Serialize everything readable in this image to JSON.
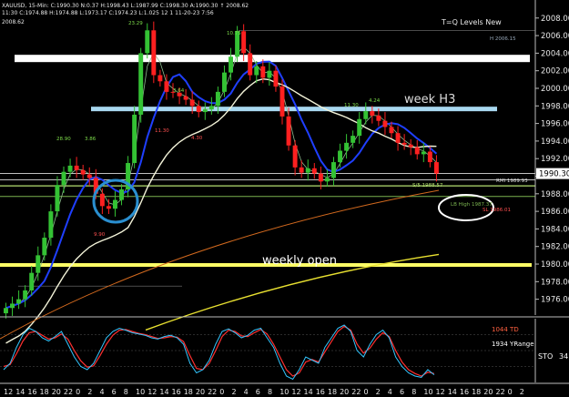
{
  "header": {
    "symbol_line": "XAUUSD, 15-Min: C:1990.30 N:0.37 H:1998.43 L:1987.99 C:1998.30 A:1990.30 ↑ 2008.62",
    "line2": "11:30 C:1974.88 H:1974.88 L:1973.17 C:1974.23 L:1.025 12 1 11-20-23 7:56",
    "left_value": "2008.62"
  },
  "chart_data": {
    "type": "candlestick",
    "title": "T=Q Levels New",
    "ylim": [
      1974,
      2009
    ],
    "y_ticks": [
      1976,
      1978,
      1980,
      1982,
      1984,
      1986,
      1988,
      1990,
      1992,
      1994,
      1996,
      1998,
      2000,
      2002,
      2004,
      2006,
      2008
    ],
    "y_tick_labels": [
      "1976.00",
      "1978.00",
      "1980.00",
      "1982.00",
      "1984.00",
      "1986.00",
      "1988.00",
      "1990.00",
      "1992.00",
      "1994.00",
      "1996.00",
      "1998.00",
      "2000.00",
      "2002.00",
      "2004.00",
      "2006.00",
      "2008.00"
    ],
    "last_price": "1990.30",
    "x_tick_labels": [
      "12",
      "14",
      "16",
      "18",
      "20",
      "22",
      "0",
      "2",
      "4",
      "6",
      "8",
      "10",
      "12",
      "14",
      "16",
      "18",
      "20",
      "22",
      "0",
      "2",
      "4",
      "6",
      "8",
      "10",
      "12",
      "14",
      "16",
      "18",
      "20",
      "22",
      "0",
      "2",
      "4",
      "6",
      "8",
      "10",
      "12",
      "14",
      "16",
      "18",
      "20",
      "22",
      "0",
      "2"
    ],
    "close_series": [
      1975,
      1975.5,
      1976,
      1977,
      1979,
      1981,
      1983,
      1986,
      1989,
      1990.5,
      1991.2,
      1990.7,
      1990.2,
      1989.8,
      1988,
      1986.6,
      1986.3,
      1987.3,
      1988.5,
      1991.5,
      1997,
      2004,
      2006.6,
      2001.5,
      2000.8,
      1999.6,
      1999.5,
      1999.1,
      1998.7,
      1998,
      1997.3,
      1997.6,
      1998,
      1999.6,
      2001.8,
      2003.6,
      2006.5,
      2004,
      2001.5,
      2002.5,
      2001.2,
      2002,
      2000.2,
      1996.8,
      1993.5,
      1991,
      1990.4,
      1990.9,
      1990.3,
      1989.4,
      1989.8,
      1991.6,
      1992.9,
      1993.8,
      1994.6,
      1996.5,
      1997.4,
      1996.9,
      1996.3,
      1995.6,
      1994.9,
      1993.8,
      1993.6,
      1993.3,
      1992.5,
      1992.8,
      1991.6,
      1990.3
    ],
    "horizontal_levels": [
      {
        "name": "week-h4",
        "value": 2003.4,
        "color": "#ffffff"
      },
      {
        "name": "week-h3",
        "value": 1997.6,
        "color": "#a8d8f0"
      },
      {
        "name": "weekly-open",
        "value": 1979.9,
        "color": "#ffff66"
      },
      {
        "name": "m5-level",
        "value": 1990.3,
        "color": "#ffffff"
      },
      {
        "name": "h5-level",
        "value": 1989.6,
        "color": "#ffffff"
      },
      {
        "name": "green-level",
        "value": 1988.9,
        "color": "#b4e070"
      },
      {
        "name": "green-level-2",
        "value": 1987.7,
        "color": "#7ab34f"
      }
    ],
    "moving_averages": [
      {
        "name": "ma-blue",
        "color": "#1f3fff"
      },
      {
        "name": "ma-white",
        "color": "#f2f2d8"
      },
      {
        "name": "ma-orange",
        "color": "#d2691e"
      },
      {
        "name": "ma-yellow",
        "color": "#e8e030"
      },
      {
        "name": "ma-thin",
        "color": "#8fbc8f"
      }
    ],
    "annotations": {
      "week_h3": "week H3",
      "weekly_open": "weekly open",
      "peak_a": "23.29",
      "peak_b": "10.75",
      "peak_c": "2006.15",
      "peak_c_prefix": "H",
      "label_s1": "11.30",
      "label_s2": "4.24",
      "label_r1": "28.90",
      "label_r2": "3.86",
      "label_low": "9.90",
      "label_mid1": "3.64",
      "label_mid2": "11.30",
      "label_mid3": "4.30",
      "label_left_val": "2008.62",
      "rmi_label": "RMI 1989.93",
      "s5_label": "S/5 1988.57",
      "lb_high": "LB High 1987.37",
      "s_low": "SL 1986.01"
    },
    "oscillator": {
      "label_td": "1044 TD",
      "label_yrange": "1934 YRange",
      "label_sto": "STO",
      "sto_value": "34",
      "ylim": [
        0,
        100
      ],
      "y_ticks": [
        25,
        50,
        75
      ],
      "k_series": [
        20,
        30,
        55,
        75,
        85,
        80,
        70,
        65,
        72,
        80,
        60,
        40,
        25,
        20,
        30,
        50,
        70,
        80,
        85,
        82,
        78,
        76,
        74,
        70,
        68,
        72,
        74,
        70,
        60,
        30,
        15,
        20,
        35,
        60,
        80,
        84,
        78,
        70,
        74,
        82,
        85,
        70,
        55,
        30,
        10,
        5,
        20,
        40,
        35,
        30,
        55,
        70,
        85,
        90,
        80,
        50,
        40,
        60,
        75,
        82,
        70,
        40,
        25,
        15,
        10,
        8,
        20,
        12
      ],
      "d_series": [
        25,
        28,
        45,
        65,
        78,
        80,
        74,
        68,
        70,
        76,
        68,
        50,
        34,
        24,
        26,
        42,
        60,
        74,
        82,
        83,
        80,
        77,
        75,
        72,
        69,
        70,
        72,
        71,
        64,
        42,
        22,
        20,
        30,
        50,
        72,
        82,
        80,
        73,
        72,
        78,
        83,
        76,
        60,
        40,
        20,
        10,
        15,
        32,
        36,
        32,
        48,
        64,
        80,
        88,
        82,
        60,
        46,
        54,
        68,
        78,
        72,
        50,
        32,
        20,
        14,
        10,
        16,
        14
      ]
    }
  },
  "colors": {
    "background": "#000000",
    "up_candle": "#34c234",
    "down_candle": "#ff2020",
    "price_box": "#ffffff"
  }
}
